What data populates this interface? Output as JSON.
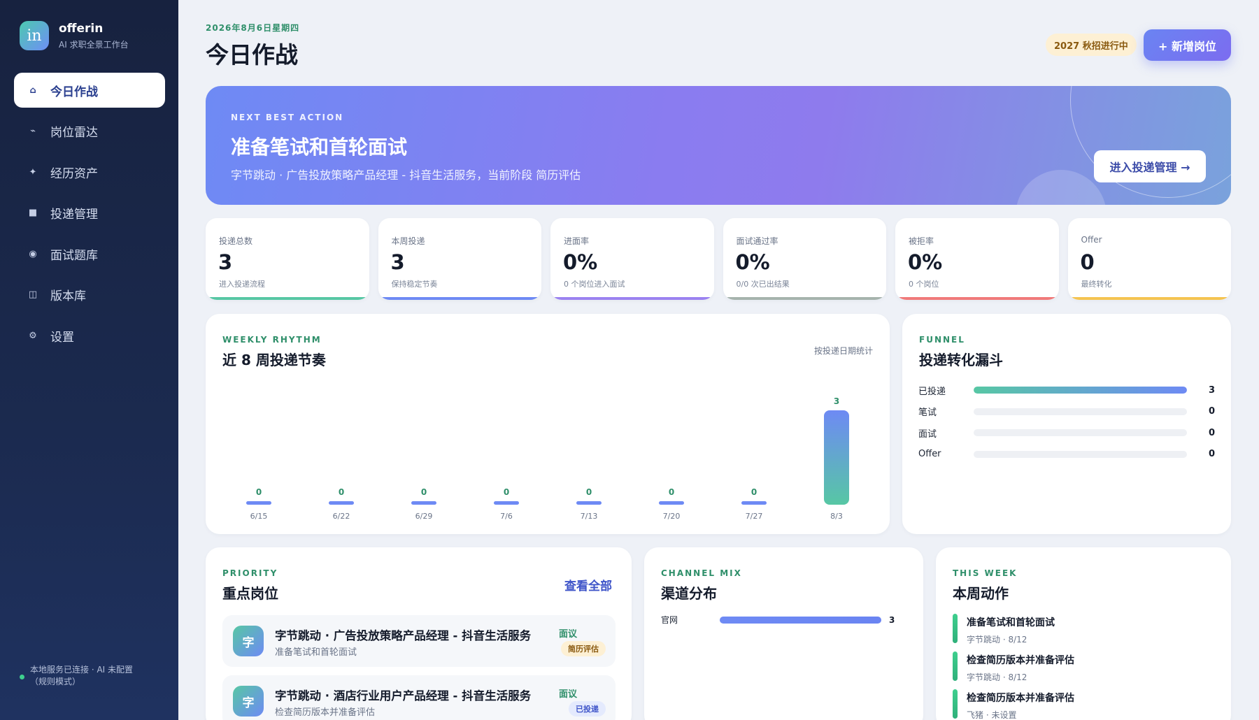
{
  "brand": {
    "logo": "in",
    "name": "offerin",
    "subtitle": "AI 求职全景工作台"
  },
  "nav": [
    {
      "label": "今日作战",
      "icon": "⌂",
      "icon_name": "home-icon",
      "active": true
    },
    {
      "label": "岗位雷达",
      "icon": "⌁",
      "icon_name": "radar-icon"
    },
    {
      "label": "经历资产",
      "icon": "✦",
      "icon_name": "sparkle-icon"
    },
    {
      "label": "投递管理",
      "icon": "■",
      "icon_name": "grid-icon"
    },
    {
      "label": "面试题库",
      "icon": "◉",
      "icon_name": "target-icon"
    },
    {
      "label": "版本库",
      "icon": "◫",
      "icon_name": "versions-icon"
    },
    {
      "label": "设置",
      "icon": "⚙",
      "icon_name": "gear-icon"
    }
  ],
  "status_text": "本地服务已连接 · AI 未配置（规则模式）",
  "header": {
    "date": "2026年8月6日星期四",
    "title": "今日作战",
    "season_badge": "2027 秋招进行中",
    "add_button": "+ 新增岗位"
  },
  "hero": {
    "kicker": "NEXT BEST ACTION",
    "title": "准备笔试和首轮面试",
    "desc": "字节跳动 · 广告投放策略产品经理 - 抖音生活服务，当前阶段 简历评估",
    "button": "进入投递管理 →"
  },
  "stats": [
    {
      "label": "投递总数",
      "value": "3",
      "sub": "进入投递流程",
      "color": "#57c7a4"
    },
    {
      "label": "本周投递",
      "value": "3",
      "sub": "保持稳定节奏",
      "color": "#6e8af4"
    },
    {
      "label": "进面率",
      "value": "0%",
      "sub": "0 个岗位进入面试",
      "color": "#9b82f0"
    },
    {
      "label": "面试通过率",
      "value": "0%",
      "sub": "0/0 次已出结果",
      "color": "#a6b3ad"
    },
    {
      "label": "被拒率",
      "value": "0%",
      "sub": "0 个岗位",
      "color": "#f07a7a"
    },
    {
      "label": "Offer",
      "value": "0",
      "sub": "最终转化",
      "color": "#f5c451"
    }
  ],
  "rhythm": {
    "kicker": "WEEKLY RHYTHM",
    "title": "近 8 周投递节奏",
    "note": "按投递日期统计"
  },
  "chart_data": {
    "type": "bar",
    "title": "近 8 周投递节奏",
    "categories": [
      "6/15",
      "6/22",
      "6/29",
      "7/6",
      "7/13",
      "7/20",
      "7/27",
      "8/3"
    ],
    "values": [
      0,
      0,
      0,
      0,
      0,
      0,
      0,
      3
    ],
    "ylim": [
      0,
      3
    ],
    "grid": false
  },
  "funnel": {
    "kicker": "FUNNEL",
    "title": "投递转化漏斗",
    "rows": [
      {
        "label": "已投递",
        "count": "3",
        "fraction": 1
      },
      {
        "label": "笔试",
        "count": "0",
        "fraction": 0
      },
      {
        "label": "面试",
        "count": "0",
        "fraction": 0
      },
      {
        "label": "Offer",
        "count": "0",
        "fraction": 0
      }
    ]
  },
  "priority": {
    "kicker": "PRIORITY",
    "title": "重点岗位",
    "view_all": "查看全部",
    "jobs": [
      {
        "avatar": "字",
        "title": "字节跳动 · 广告投放策略产品经理 - 抖音生活服务",
        "sub": "准备笔试和首轮面试",
        "prio": "面议",
        "stage": "简历评估",
        "stage_bg": "#fdf0d4",
        "stage_color": "#8a5a10"
      },
      {
        "avatar": "字",
        "title": "字节跳动 · 酒店行业用户产品经理 - 抖音生活服务",
        "sub": "检查简历版本并准备评估",
        "prio": "面议",
        "stage": "已投递",
        "stage_bg": "#e4eafd",
        "stage_color": "#3f55c9"
      }
    ]
  },
  "channel": {
    "kicker": "CHANNEL MIX",
    "title": "渠道分布",
    "rows": [
      {
        "label": "官网",
        "count": "3",
        "fraction": 1
      }
    ]
  },
  "week": {
    "kicker": "THIS WEEK",
    "title": "本周动作",
    "items": [
      {
        "title": "准备笔试和首轮面试",
        "sub": "字节跳动 · 8/12"
      },
      {
        "title": "检查简历版本并准备评估",
        "sub": "字节跳动 · 8/12"
      },
      {
        "title": "检查简历版本并准备评估",
        "sub": "飞猪 · 未设置"
      }
    ]
  }
}
